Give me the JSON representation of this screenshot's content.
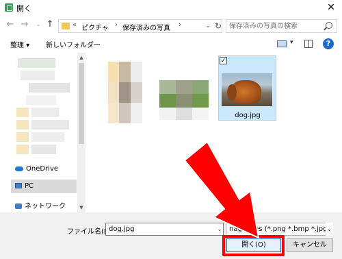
{
  "window": {
    "title": "開く",
    "close": "✕"
  },
  "nav": {
    "back": "←",
    "forward": "→",
    "dropdown": "⌄",
    "up": "↑"
  },
  "address": {
    "breadcrumbs": [
      {
        "label": "ピクチャ"
      },
      {
        "label": "保存済みの写真"
      }
    ],
    "lead": "«",
    "sep": "›",
    "dropdown": "⌄",
    "refresh": "↻"
  },
  "search": {
    "placeholder": "保存済みの写真の検索"
  },
  "toolbar": {
    "organize": "整理 ▾",
    "new_folder": "新しいフォルダー",
    "view_dropdown": "▾",
    "help": "?"
  },
  "sidebar": {
    "items": [
      {
        "label": "OneDrive"
      },
      {
        "label": "PC"
      },
      {
        "label": "ネットワーク"
      }
    ]
  },
  "scroll": {
    "up": "▲",
    "down": "▼"
  },
  "files": [
    {
      "name": "dog.jpg",
      "checkmark": "✓"
    }
  ],
  "footer": {
    "filename_label": "ファイル名(N):",
    "filename_value": "dog.jpg",
    "filetype_value": "nage files (*.png *.bmp *.jpg *",
    "dropdown": "⌄",
    "open_button": "開く(O)",
    "cancel_button": "キャンセル"
  },
  "colors": {
    "accent": "#0078d7",
    "highlight": "#ff0000",
    "selection": "#cce8ff"
  }
}
